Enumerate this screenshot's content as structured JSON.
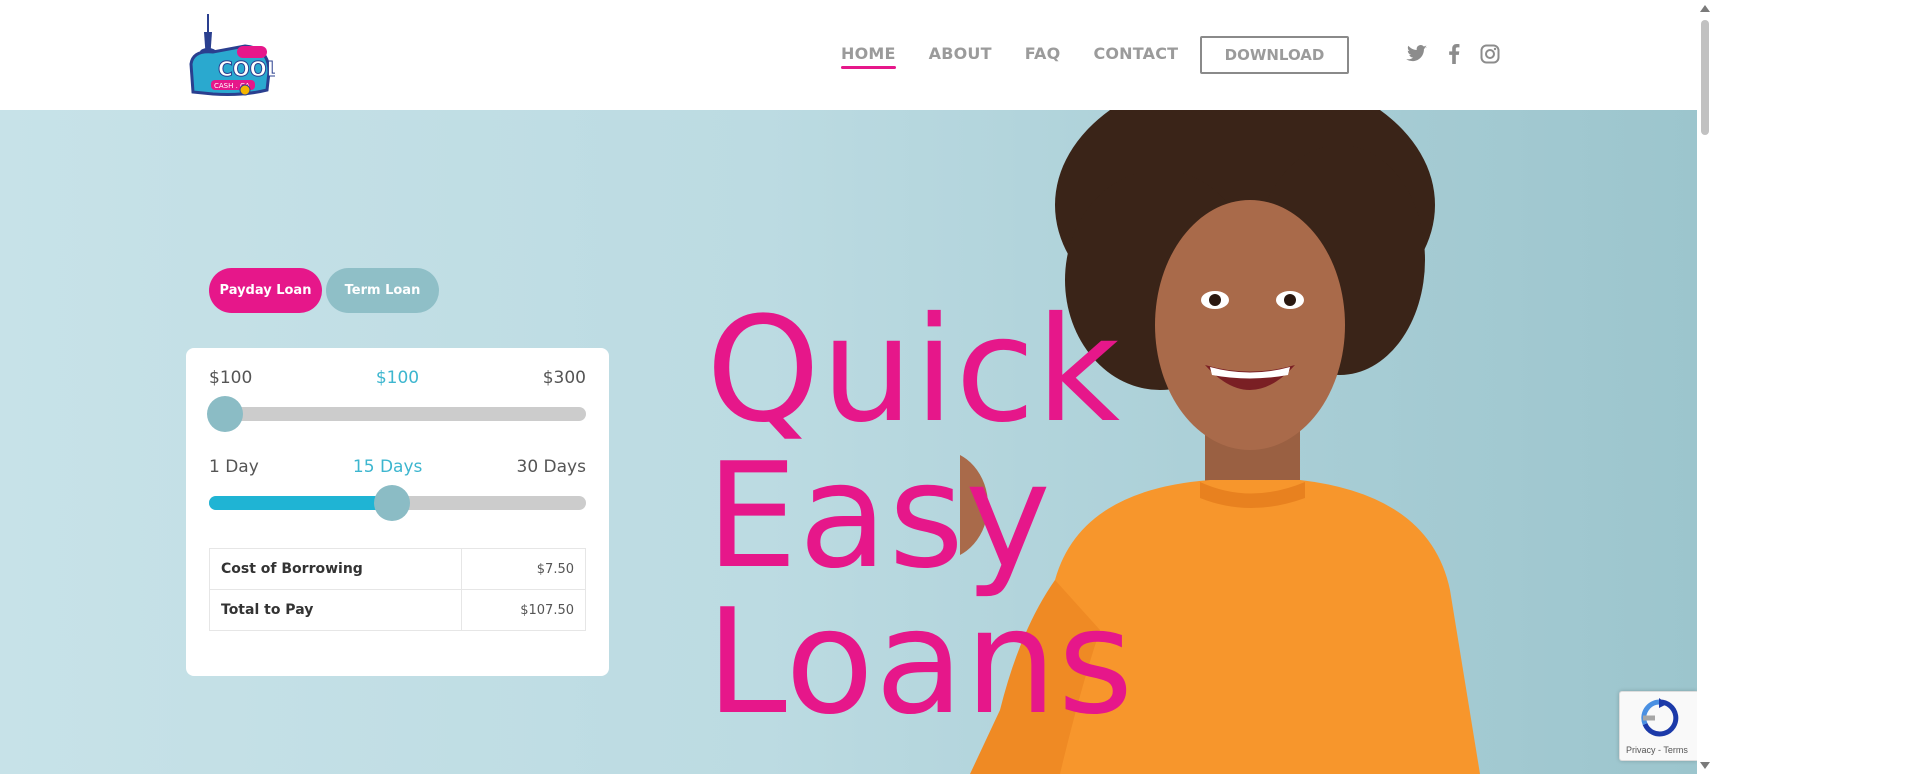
{
  "header": {
    "logo_alt": "Cool Cash CA logo",
    "nav": [
      {
        "label": "HOME",
        "active": true
      },
      {
        "label": "ABOUT",
        "active": false
      },
      {
        "label": "FAQ",
        "active": false
      },
      {
        "label": "CONTACT",
        "active": false
      }
    ],
    "download_label": "DOWNLOAD",
    "social": [
      "twitter-icon",
      "facebook-icon",
      "instagram-icon"
    ]
  },
  "hero": {
    "tabs": {
      "payday": "Payday Loan",
      "term": "Term Loan"
    },
    "amount": {
      "min": "$100",
      "current": "$100",
      "max": "$300",
      "fraction": 0
    },
    "days": {
      "min": "1 Day",
      "current": "15 Days",
      "max": "30 Days",
      "fraction": 0.4828
    },
    "cost": {
      "borrowing_label": "Cost of Borrowing",
      "borrowing_value": "$7.50",
      "total_label": "Total to Pay",
      "total_value": "$107.50"
    },
    "headline": [
      "Quick",
      "Easy",
      "Loans"
    ]
  },
  "recaptcha": {
    "text": "Privacy - Terms"
  },
  "colors": {
    "accent": "#e6178a",
    "teal": "#3db6cf",
    "knob": "#8bbcc5",
    "background": "#bcdbe2"
  }
}
